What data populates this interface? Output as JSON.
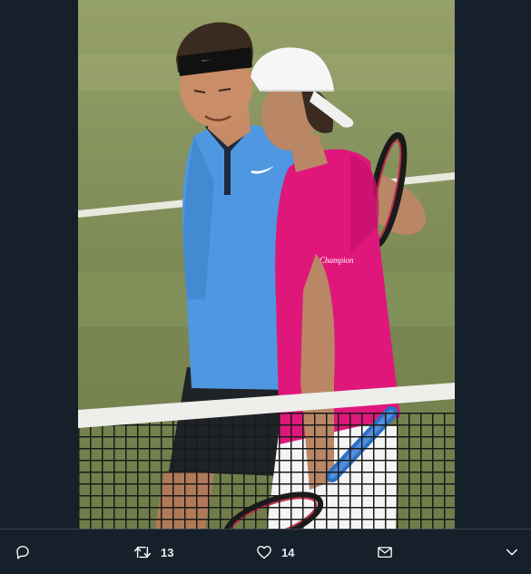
{
  "media": {
    "shirt_text": "Champion"
  },
  "actions": {
    "reply_icon": "reply-icon",
    "retweet_icon": "retweet-icon",
    "retweet_count": "13",
    "like_icon": "heart-icon",
    "like_count": "14",
    "dm_icon": "envelope-icon",
    "more_icon": "chevron-down-icon"
  },
  "colors": {
    "background": "#15202b",
    "icon": "#ffffff",
    "court_grass": "#7f8c57",
    "shirt_blue": "#4f97e0",
    "shirt_pink": "#e0177a"
  }
}
